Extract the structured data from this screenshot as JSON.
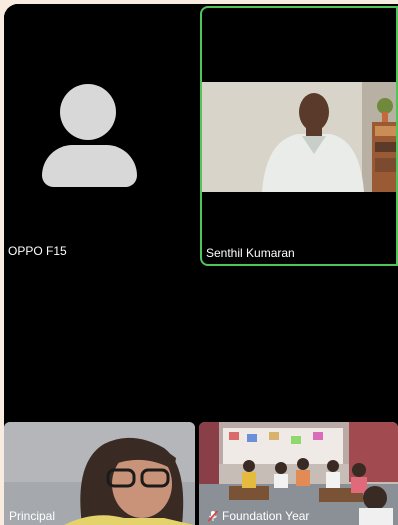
{
  "participants": [
    {
      "name": "OPPO F15",
      "video": false
    },
    {
      "name": "Senthil Kumaran",
      "video": true,
      "active_speaker": true
    },
    {
      "name": "Principal",
      "video": true
    },
    {
      "name": "Foundation Year",
      "video": true,
      "muted": true
    }
  ],
  "colors": {
    "background": "#f7ecdf",
    "grid": "#000000",
    "active_speaker_border": "#52c45a",
    "avatar": "#d8d8d8"
  },
  "icons": {
    "muted": "mic-off-icon",
    "no_video": "avatar-placeholder-icon"
  }
}
